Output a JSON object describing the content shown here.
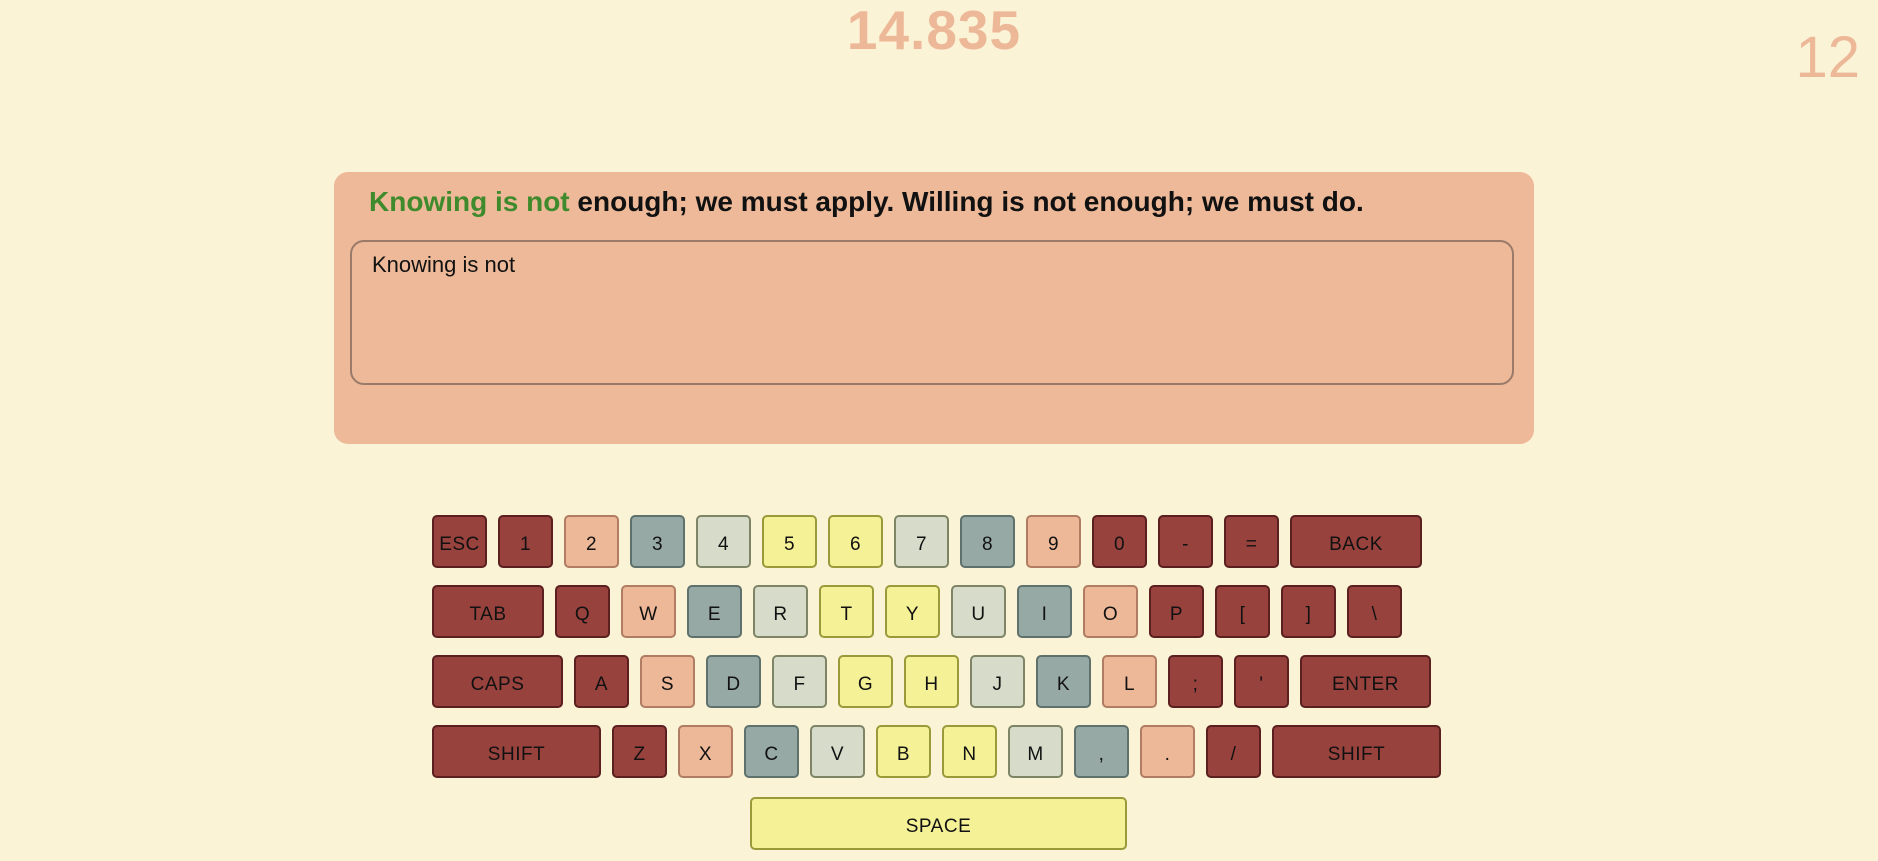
{
  "timer": "14.835",
  "counter": "12",
  "prompt": {
    "typed": "Knowing is not",
    "remaining": " enough; we must apply. Willing is not enough; we must do."
  },
  "input": {
    "value": "Knowing is not"
  },
  "colors": {
    "background": "#fbf3d6",
    "panel": "#edb998",
    "typed_text": "#3f8a2c",
    "key_red": "#98423e",
    "key_pink": "#edb898",
    "key_slate": "#97a9a5",
    "key_pale": "#d6dcc9",
    "key_yellow": "#f5f197"
  },
  "keyboard": {
    "rows": [
      [
        {
          "label": "ESC",
          "color": "red"
        },
        {
          "label": "1",
          "color": "red"
        },
        {
          "label": "2",
          "color": "pink"
        },
        {
          "label": "3",
          "color": "slate"
        },
        {
          "label": "4",
          "color": "pale"
        },
        {
          "label": "5",
          "color": "yellow"
        },
        {
          "label": "6",
          "color": "yellow"
        },
        {
          "label": "7",
          "color": "pale"
        },
        {
          "label": "8",
          "color": "slate"
        },
        {
          "label": "9",
          "color": "pink"
        },
        {
          "label": "0",
          "color": "red"
        },
        {
          "label": "-",
          "color": "red"
        },
        {
          "label": "=",
          "color": "red"
        },
        {
          "label": "BACK",
          "color": "red"
        }
      ],
      [
        {
          "label": "TAB",
          "color": "red"
        },
        {
          "label": "Q",
          "color": "red"
        },
        {
          "label": "W",
          "color": "pink"
        },
        {
          "label": "E",
          "color": "slate"
        },
        {
          "label": "R",
          "color": "pale"
        },
        {
          "label": "T",
          "color": "yellow"
        },
        {
          "label": "Y",
          "color": "yellow"
        },
        {
          "label": "U",
          "color": "pale"
        },
        {
          "label": "I",
          "color": "slate"
        },
        {
          "label": "O",
          "color": "pink"
        },
        {
          "label": "P",
          "color": "red"
        },
        {
          "label": "[",
          "color": "red"
        },
        {
          "label": "]",
          "color": "red"
        },
        {
          "label": "\\",
          "color": "red"
        }
      ],
      [
        {
          "label": "CAPS",
          "color": "red"
        },
        {
          "label": "A",
          "color": "red"
        },
        {
          "label": "S",
          "color": "pink"
        },
        {
          "label": "D",
          "color": "slate"
        },
        {
          "label": "F",
          "color": "pale"
        },
        {
          "label": "G",
          "color": "yellow"
        },
        {
          "label": "H",
          "color": "yellow"
        },
        {
          "label": "J",
          "color": "pale"
        },
        {
          "label": "K",
          "color": "slate"
        },
        {
          "label": "L",
          "color": "pink"
        },
        {
          "label": ";",
          "color": "red"
        },
        {
          "label": "'",
          "color": "red"
        },
        {
          "label": "ENTER",
          "color": "red"
        }
      ],
      [
        {
          "label": "SHIFT",
          "color": "red"
        },
        {
          "label": "Z",
          "color": "red"
        },
        {
          "label": "X",
          "color": "pink"
        },
        {
          "label": "C",
          "color": "slate"
        },
        {
          "label": "V",
          "color": "pale"
        },
        {
          "label": "B",
          "color": "yellow"
        },
        {
          "label": "N",
          "color": "yellow"
        },
        {
          "label": "M",
          "color": "pale"
        },
        {
          "label": ",",
          "color": "slate"
        },
        {
          "label": ".",
          "color": "pink"
        },
        {
          "label": "/",
          "color": "red"
        },
        {
          "label": "SHIFT",
          "color": "red"
        }
      ],
      [
        {
          "label": "SPACE",
          "color": "yellow"
        }
      ]
    ]
  }
}
